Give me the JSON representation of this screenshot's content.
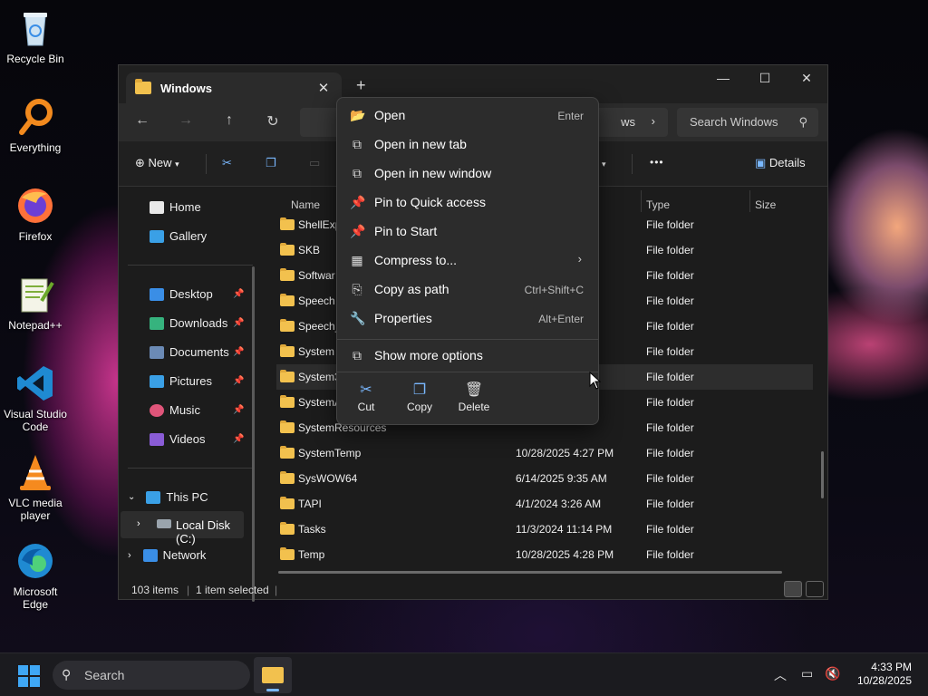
{
  "desktop": {
    "icons": [
      {
        "label": "Recycle Bin",
        "icon": "recycle-bin-icon"
      },
      {
        "label": "Everything",
        "icon": "magnifier-icon"
      },
      {
        "label": "Firefox",
        "icon": "firefox-icon"
      },
      {
        "label": "Notepad++",
        "icon": "notepad-icon"
      },
      {
        "label": "Visual Studio Code",
        "icon": "vscode-icon"
      },
      {
        "label": "VLC media player",
        "icon": "vlc-cone-icon"
      },
      {
        "label": "Microsoft Edge",
        "icon": "edge-icon"
      }
    ]
  },
  "window": {
    "tab_title": "Windows",
    "tab_close": "✕",
    "new_tab": "+",
    "controls": {
      "minimize": "—",
      "maximize": "☐",
      "close": "✕"
    },
    "address": {
      "visible_crumb": "ws",
      "chevron": "›"
    },
    "search_placeholder": "Search Windows",
    "toolbar": {
      "new_label": "New",
      "view_label": "w",
      "more": "•••",
      "details_label": "Details"
    },
    "sidebar": {
      "home": "Home",
      "gallery": "Gallery",
      "quick": [
        {
          "label": "Desktop",
          "color": "#3a8ee6"
        },
        {
          "label": "Downloads",
          "color": "#36b37e"
        },
        {
          "label": "Documents",
          "color": "#6b8ab5"
        },
        {
          "label": "Pictures",
          "color": "#3aa0e6"
        },
        {
          "label": "Music",
          "color": "#e0557a"
        },
        {
          "label": "Videos",
          "color": "#8a5cd6"
        }
      ],
      "this_pc": "This PC",
      "local_disk": "Local Disk (C:)",
      "network": "Network"
    },
    "columns": {
      "name": "Name",
      "type": "Type",
      "size": "Size"
    },
    "files": [
      {
        "name": "ShellExp",
        "date": "M",
        "type": "File folder"
      },
      {
        "name": "SKB",
        "date": "",
        "type": "File folder"
      },
      {
        "name": "Softwar",
        "date": "M",
        "type": "File folder"
      },
      {
        "name": "Speech",
        "date": "",
        "type": "File folder"
      },
      {
        "name": "Speech_",
        "date": "",
        "type": "File folder"
      },
      {
        "name": "System",
        "date": "",
        "type": "File folder"
      },
      {
        "name": "System3",
        "date": "M",
        "type": "File folder"
      },
      {
        "name": "SystemA",
        "date": "",
        "type": "File folder"
      },
      {
        "name": "SystemResources",
        "date": "",
        "type": "File folder"
      },
      {
        "name": "SystemTemp",
        "date": "10/28/2025 4:27 PM",
        "type": "File folder"
      },
      {
        "name": "SysWOW64",
        "date": "6/14/2025 9:35 AM",
        "type": "File folder"
      },
      {
        "name": "TAPI",
        "date": "4/1/2024 3:26 AM",
        "type": "File folder"
      },
      {
        "name": "Tasks",
        "date": "11/3/2024 11:14 PM",
        "type": "File folder"
      },
      {
        "name": "Temp",
        "date": "10/28/2025 4:28 PM",
        "type": "File folder"
      }
    ],
    "status": {
      "items": "103 items",
      "selected": "1 item selected"
    }
  },
  "context_menu": {
    "items": [
      {
        "label": "Open",
        "shortcut": "Enter",
        "icon": "folder-open-icon"
      },
      {
        "label": "Open in new tab",
        "shortcut": "",
        "icon": "new-tab-icon"
      },
      {
        "label": "Open in new window",
        "shortcut": "",
        "icon": "new-window-icon"
      },
      {
        "label": "Pin to Quick access",
        "shortcut": "",
        "icon": "pin-icon"
      },
      {
        "label": "Pin to Start",
        "shortcut": "",
        "icon": "pin-icon"
      },
      {
        "label": "Compress to...",
        "shortcut": "",
        "icon": "archive-icon"
      },
      {
        "label": "Copy as path",
        "shortcut": "Ctrl+Shift+C",
        "icon": "path-icon"
      },
      {
        "label": "Properties",
        "shortcut": "Alt+Enter",
        "icon": "wrench-icon"
      }
    ],
    "more": "Show more options",
    "quick_actions": [
      {
        "label": "Cut",
        "icon": "scissors-icon"
      },
      {
        "label": "Copy",
        "icon": "copy-icon"
      },
      {
        "label": "Delete",
        "icon": "trash-icon"
      }
    ]
  },
  "taskbar": {
    "search_label": "Search",
    "time": "4:33 PM",
    "date": "10/28/2025"
  }
}
